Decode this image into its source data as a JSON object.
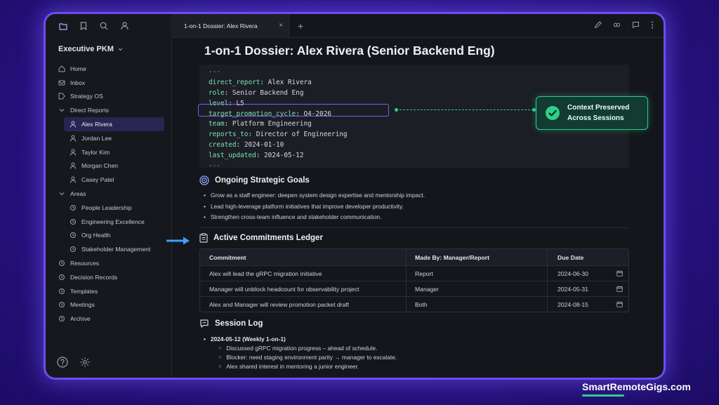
{
  "sidebar": {
    "vault_name": "Executive PKM",
    "items": [
      {
        "label": "Home",
        "icon": "home-icon"
      },
      {
        "label": "Inbox",
        "icon": "inbox-icon"
      },
      {
        "label": "Strategy OS",
        "icon": "tag-icon"
      },
      {
        "label": "Direct Reports",
        "icon": "chevron-down-icon"
      },
      {
        "label": "Alex Rivera",
        "icon": "person-icon"
      },
      {
        "label": "Jordan Lee",
        "icon": "person-icon"
      },
      {
        "label": "Taylor Kim",
        "icon": "person-icon"
      },
      {
        "label": "Morgan Chen",
        "icon": "person-icon"
      },
      {
        "label": "Casey Patel",
        "icon": "person-icon"
      },
      {
        "label": "Areas",
        "icon": "chevron-down-icon"
      },
      {
        "label": "People Leadership",
        "icon": "area-icon"
      },
      {
        "label": "Engineering Excellence",
        "icon": "area-icon"
      },
      {
        "label": "Org Health",
        "icon": "area-icon"
      },
      {
        "label": "Stakeholder Management",
        "icon": "area-icon"
      },
      {
        "label": "Resources",
        "icon": "area-icon"
      },
      {
        "label": "Decision Records",
        "icon": "area-icon"
      },
      {
        "label": "Templates",
        "icon": "area-icon"
      },
      {
        "label": "Meetings",
        "icon": "area-icon"
      },
      {
        "label": "Archive",
        "icon": "area-icon"
      }
    ]
  },
  "tab": {
    "label": "1-on-1 Dossier: Alex Rivera",
    "close": "×",
    "new": "+"
  },
  "page": {
    "title": "1-on-1 Dossier: Alex Rivera (Senior Backend Eng)"
  },
  "frontmatter": {
    "open": "---",
    "rows": [
      {
        "key": "direct_report",
        "value": "Alex Rivera"
      },
      {
        "key": "role",
        "value": "Senior Backend Eng"
      },
      {
        "key": "level",
        "value": "L5"
      },
      {
        "key": "target_promotion_cycle",
        "value": "Q4-2026"
      },
      {
        "key": "team",
        "value": "Platform Engineering"
      },
      {
        "key": "reports_to",
        "value": "Director of Engineering"
      },
      {
        "key": "created",
        "value": "2024-01-10"
      },
      {
        "key": "last_updated",
        "value": "2024-05-12"
      }
    ],
    "close": "---"
  },
  "callout": {
    "line1": "Context Preserved",
    "line2": "Across Sessions"
  },
  "goals": {
    "heading": "Ongoing Strategic Goals",
    "items": [
      "Grow as a staff engineer: deepen system design expertise and mentorship impact.",
      "Lead high-leverage platform initiatives that improve developer productivity.",
      "Strengthen cross-team influence and stakeholder communication."
    ]
  },
  "ledger": {
    "heading": "Active Commitments Ledger",
    "columns": [
      "Commitment",
      "Made By: Manager/Report",
      "Due Date"
    ],
    "rows": [
      [
        "Alex will lead the gRPC migration initiative",
        "Report",
        "2024-06-30"
      ],
      [
        "Manager will unblock headcount for observability project",
        "Manager",
        "2024-05-31"
      ],
      [
        "Alex and Manager will review promotion packet draft",
        "Both",
        "2024-08-15"
      ]
    ]
  },
  "session_log": {
    "heading": "Session Log",
    "entry": "2024-05-12 (Weekly 1-on-1)",
    "notes": [
      "Discussed gRPC migration progress – ahead of schedule.",
      "Blocker: need staging environment parity → manager to escalate.",
      "Alex shared interest in mentoring a junior engineer."
    ]
  },
  "brand": "SmartRemoteGigs.com",
  "colors": {
    "accent": "#7f5af0",
    "success": "#2ecf8a",
    "background": "#2a1488"
  }
}
